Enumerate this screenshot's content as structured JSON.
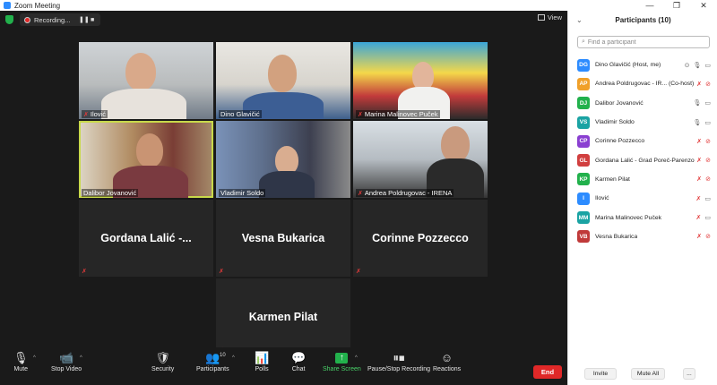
{
  "window": {
    "title": "Zoom Meeting",
    "controls": [
      "—",
      "❐",
      "✕"
    ]
  },
  "topbar": {
    "recording_label": "Recording...",
    "view_label": "View"
  },
  "tiles": [
    {
      "name": "Ilović",
      "type": "video"
    },
    {
      "name": "Dino Glavičić",
      "type": "video"
    },
    {
      "name": "Marina Malinovec Puček",
      "type": "video"
    },
    {
      "name": "Dalibor Jovanović",
      "type": "video",
      "active": true
    },
    {
      "name": "Vladimir Soldo",
      "type": "video"
    },
    {
      "name": "Andrea Poldrugovac - IRENA",
      "type": "video"
    },
    {
      "name": "Gordana  Lalić -...",
      "type": "name"
    },
    {
      "name": "Vesna Bukarica",
      "type": "name"
    },
    {
      "name": "Corinne Pozzecco",
      "type": "name"
    },
    {
      "name": "Karmen Pilat",
      "type": "name"
    }
  ],
  "toolbar": {
    "mute": "Mute",
    "stop_video": "Stop Video",
    "security": "Security",
    "participants": "Participants",
    "participants_count": "10",
    "polls": "Polls",
    "chat": "Chat",
    "share_screen": "Share Screen",
    "pause_stop_recording": "Pause/Stop Recording",
    "reactions": "Reactions",
    "end": "End"
  },
  "panel": {
    "title": "Participants (10)",
    "search_placeholder": "Find a participant",
    "participants": [
      {
        "initials": "DG",
        "name": "Dino Glavičić (Host, me)",
        "color": "#2d8cff",
        "mic": "on",
        "video": "on"
      },
      {
        "initials": "AP",
        "name": "Andrea Poldrugovac - IR...  (Co-host)",
        "color": "#f0a029",
        "mic": "off",
        "video": "off"
      },
      {
        "initials": "DJ",
        "name": "Dalibor Jovanović",
        "color": "#22b14c",
        "mic": "on",
        "video": "on"
      },
      {
        "initials": "VS",
        "name": "Vladimir Soldo",
        "color": "#1aa3a3",
        "mic": "on",
        "video": "on"
      },
      {
        "initials": "CP",
        "name": "Corinne Pozzecco",
        "color": "#8a3fd1",
        "mic": "off",
        "video": "off"
      },
      {
        "initials": "GL",
        "name": "Gordana Lalić - Grad Poreč-Parenzo",
        "color": "#d13f3f",
        "mic": "off",
        "video": "off"
      },
      {
        "initials": "KP",
        "name": "Karmen Pilat",
        "color": "#22b14c",
        "mic": "off",
        "video": "off"
      },
      {
        "initials": "I",
        "name": "Ilović",
        "color": "#2d8cff",
        "mic": "off",
        "video": "on"
      },
      {
        "initials": "MM",
        "name": "Marina Malinovec Puček",
        "color": "#1aa3a3",
        "mic": "off",
        "video": "on"
      },
      {
        "initials": "VB",
        "name": "Vesna Bukarica",
        "color": "#c03a3a",
        "mic": "off",
        "video": "off"
      }
    ],
    "invite": "Invite",
    "mute_all": "Mute All",
    "more": "..."
  }
}
